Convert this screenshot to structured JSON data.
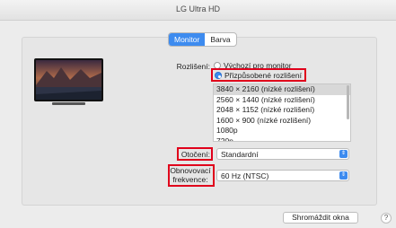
{
  "window": {
    "title": "LG Ultra HD"
  },
  "tabs": [
    {
      "label": "Monitor",
      "active": true
    },
    {
      "label": "Barva",
      "active": false
    }
  ],
  "resolution": {
    "label": "Rozlišení:",
    "options": [
      {
        "label": "Výchozí pro monitor",
        "selected": false
      },
      {
        "label": "Přizpůsobené rozlišení",
        "selected": true
      }
    ],
    "list": [
      "3840 × 2160 (nízké rozlišení)",
      "2560 × 1440 (nízké rozlišení)",
      "2048 × 1152 (nízké rozlišení)",
      "1600 × 900 (nízké rozlišení)",
      "1080p",
      "720p"
    ],
    "selected_index": 0
  },
  "rotation": {
    "label": "Otočení:",
    "value": "Standardní"
  },
  "refresh": {
    "label_line1": "Obnovovací",
    "label_line2": "frekvence:",
    "value": "60 Hz (NTSC)"
  },
  "footer": {
    "gather_button": "Shromáždit okna",
    "help": "?"
  },
  "colors": {
    "accent": "#3d8bef",
    "highlight_box": "#e0001b"
  },
  "icons": {
    "select_arrow": "chevron-up-down-icon",
    "help": "question-mark-icon"
  }
}
